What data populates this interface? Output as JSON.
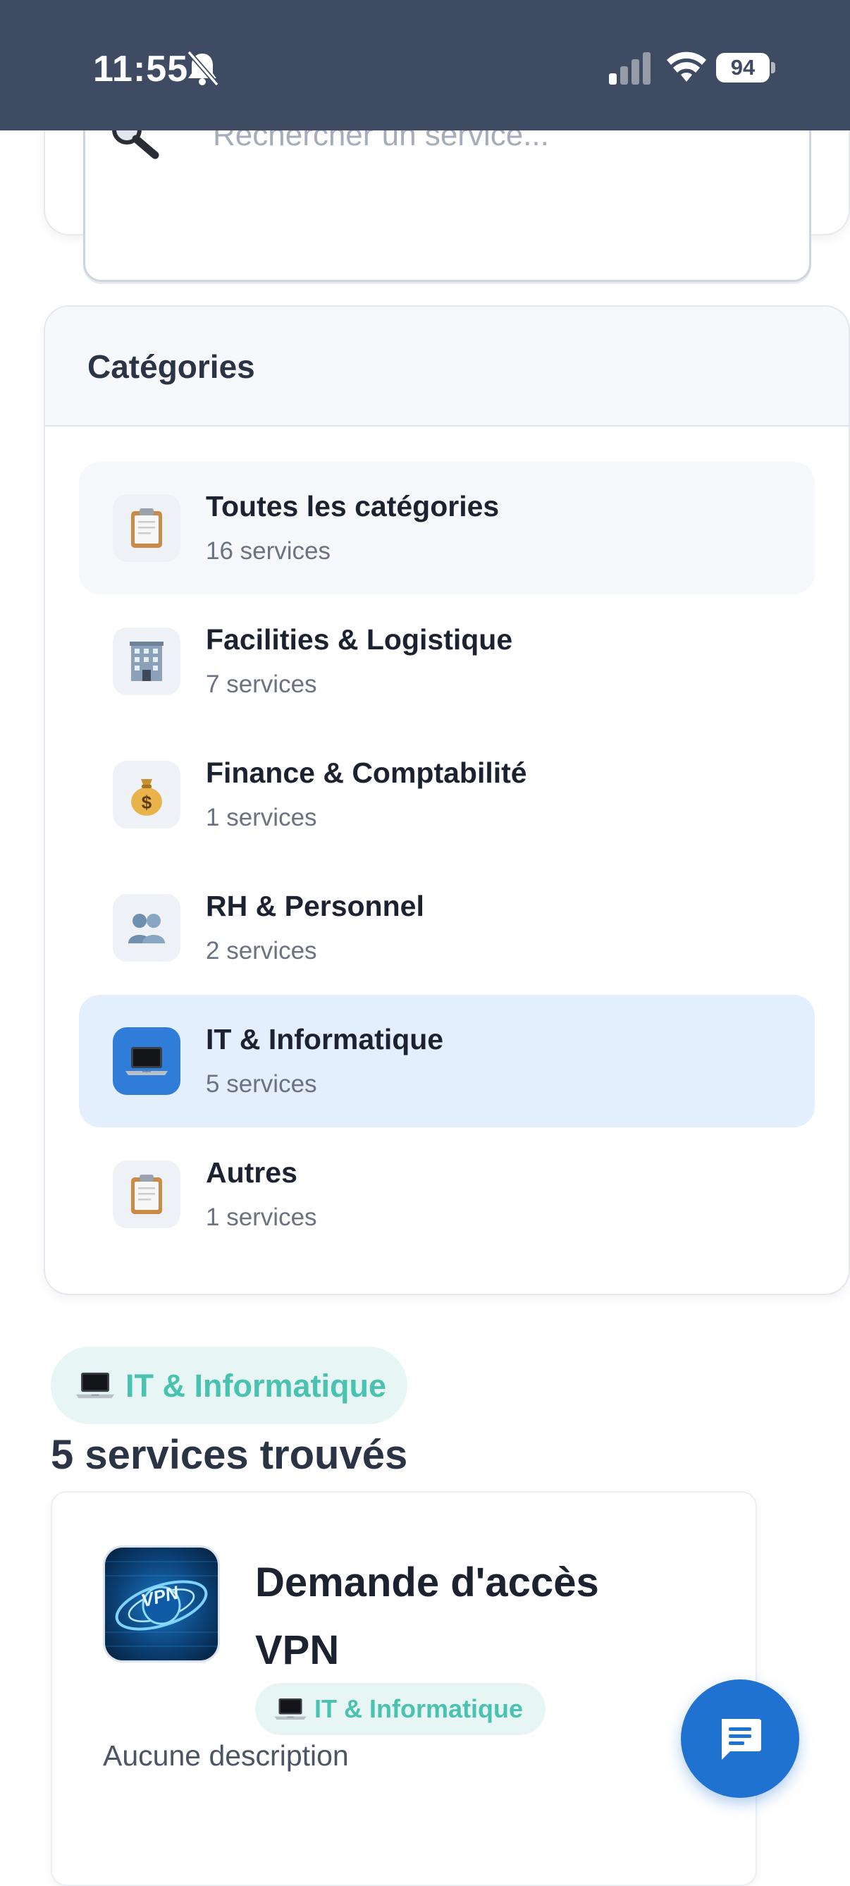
{
  "status_bar": {
    "time": "11:55",
    "battery": "94",
    "icons": [
      "bell-slash-icon",
      "signal-icon",
      "wifi-icon",
      "battery-icon"
    ]
  },
  "search": {
    "placeholder": "Rechercher un service...",
    "icon": "magnifier-icon"
  },
  "categories": {
    "title": "Catégories",
    "items": [
      {
        "icon": "clipboard-icon",
        "name": "Toutes les catégories",
        "count": "16 services"
      },
      {
        "icon": "office-building-icon",
        "name": "Facilities & Logistique",
        "count": "7 services"
      },
      {
        "icon": "money-bag-icon",
        "name": "Finance & Comptabilité",
        "count": "1 services"
      },
      {
        "icon": "people-icon",
        "name": "RH & Personnel",
        "count": "2 services"
      },
      {
        "icon": "laptop-icon",
        "name": "IT & Informatique",
        "count": "5 services"
      },
      {
        "icon": "clipboard-icon",
        "name": "Autres",
        "count": "1 services"
      }
    ],
    "active": "IT & Informatique"
  },
  "filter": {
    "label": "IT & Informatique",
    "icon": "laptop-icon"
  },
  "results": {
    "count_text": "5 services trouvés"
  },
  "service_card": {
    "title": "Demande d'accès VPN",
    "thumbnail": "vpn-image",
    "thumbnail_text": "VPN",
    "tag": "IT & Informatique",
    "description": "Aucune description"
  },
  "chat_button": {
    "icon": "chat-icon"
  },
  "colors": {
    "status_bar_bg": "#3f4b62",
    "active_item_bg": "#e3effc",
    "tag_text": "#4ac2b0",
    "tag_bg": "#e7f6f4",
    "fab_bg": "#1f72d0"
  }
}
